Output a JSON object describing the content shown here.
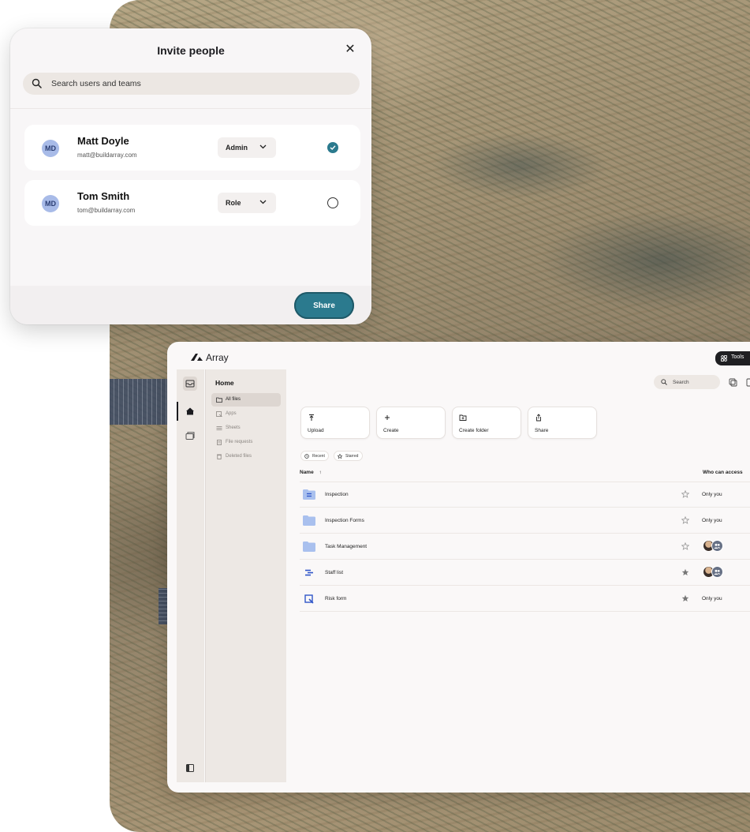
{
  "invite": {
    "title": "Invite people",
    "search_placeholder": "Search users and teams",
    "users": [
      {
        "initials": "MD",
        "name": "Matt Doyle",
        "email": "matt@buildarray.com",
        "role": "Admin",
        "selected": true
      },
      {
        "initials": "MD",
        "name": "Tom Smith",
        "email": "tom@buildarray.com",
        "role": "Role",
        "selected": false
      }
    ],
    "share_label": "Share",
    "accent_color": "#2b7a8e"
  },
  "app": {
    "brand": "Array",
    "tools_label": "Tools",
    "sidebar": {
      "title": "Home",
      "items": [
        {
          "label": "All files",
          "icon": "folder-open-icon",
          "active": true
        },
        {
          "label": "Apps",
          "icon": "apps-icon",
          "active": false
        },
        {
          "label": "Sheets",
          "icon": "sheets-icon",
          "active": false
        },
        {
          "label": "File requests",
          "icon": "file-request-icon",
          "active": false
        },
        {
          "label": "Deleted files",
          "icon": "trash-icon",
          "active": false
        }
      ]
    },
    "search_placeholder": "Search",
    "actions": [
      {
        "label": "Upload",
        "icon": "upload-icon"
      },
      {
        "label": "Create",
        "icon": "plus-icon"
      },
      {
        "label": "Create folder",
        "icon": "folder-plus-icon"
      },
      {
        "label": "Share",
        "icon": "share-icon"
      }
    ],
    "filters": [
      {
        "label": "Recent",
        "icon": "clock-icon"
      },
      {
        "label": "Starred",
        "icon": "star-icon"
      }
    ],
    "table": {
      "col_name": "Name",
      "col_access": "Who can access",
      "rows": [
        {
          "name": "Inspection",
          "type": "app-folder",
          "starred": false,
          "access": "Only you"
        },
        {
          "name": "Inspection Forms",
          "type": "folder",
          "starred": false,
          "access": "Only you"
        },
        {
          "name": "Task Management",
          "type": "folder",
          "starred": false,
          "access": ""
        },
        {
          "name": "Staff list",
          "type": "sheet",
          "starred": true,
          "access": ""
        },
        {
          "name": "Risk form",
          "type": "form",
          "starred": true,
          "access": "Only you"
        }
      ]
    }
  }
}
